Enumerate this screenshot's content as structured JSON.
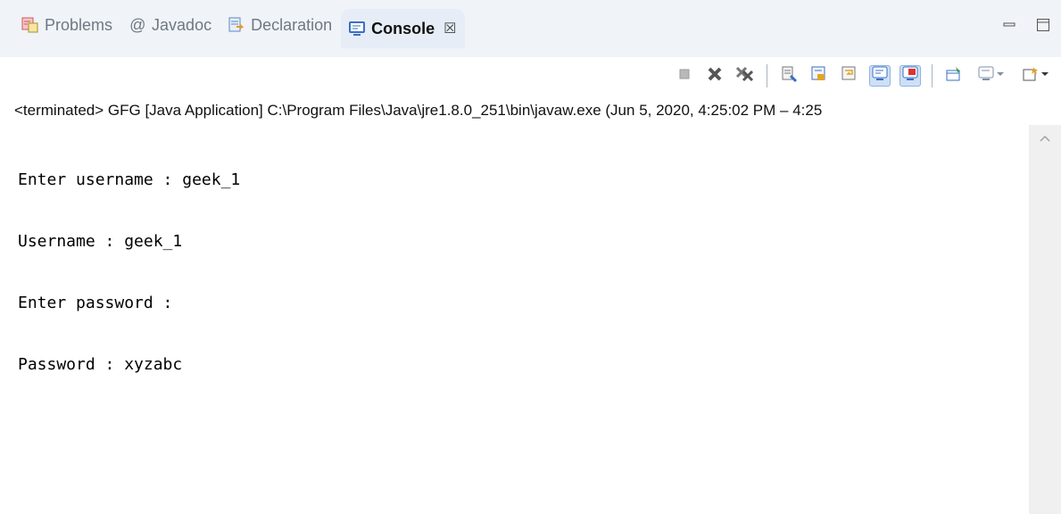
{
  "tabs": [
    {
      "label": "Problems",
      "icon": "problems-icon"
    },
    {
      "label": "Javadoc",
      "icon": "javadoc-at-icon"
    },
    {
      "label": "Declaration",
      "icon": "declaration-icon"
    },
    {
      "label": "Console",
      "icon": "console-icon",
      "active": true,
      "close_glyph": "☒"
    }
  ],
  "toolbar_icons": [
    "terminate-icon",
    "remove-launch-icon",
    "remove-all-terminated-icon",
    "clear-console-icon",
    "scroll-lock-icon",
    "word-wrap-icon",
    "show-on-stdout-icon",
    "show-on-stderr-icon",
    "pin-console-icon",
    "display-selected-console-icon",
    "open-console-icon"
  ],
  "status_line": "<terminated> GFG [Java Application] C:\\Program Files\\Java\\jre1.8.0_251\\bin\\javaw.exe  (Jun 5, 2020, 4:25:02 PM – 4:25",
  "console_lines": [
    "Enter username : geek_1",
    "Username : geek_1",
    "Enter password :",
    "Password : xyzabc"
  ],
  "colors": {
    "tabbar_bg": "#f0f3f7",
    "active_tab_bg": "#e6edf6",
    "scrollbar_bg": "#f0f0f0"
  }
}
